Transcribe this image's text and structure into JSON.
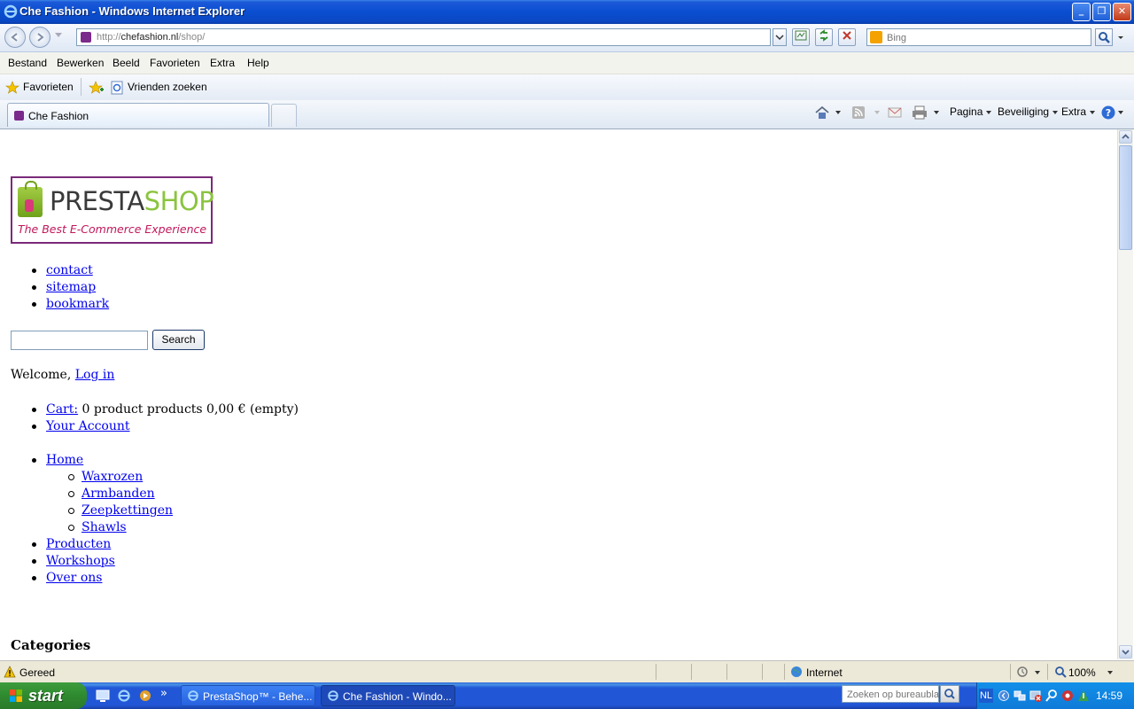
{
  "window": {
    "title": "Che Fashion - Windows Internet Explorer",
    "minimize_label": "_",
    "maximize_label": "❐",
    "close_label": "✕"
  },
  "address": {
    "url_prefix": "http://",
    "url_host": "chefashion.nl",
    "url_path": "/shop/",
    "search_placeholder": "Bing"
  },
  "menu": [
    "Bestand",
    "Bewerken",
    "Beeld",
    "Favorieten",
    "Extra",
    "Help"
  ],
  "favorites_bar": {
    "favorites_label": "Favorieten",
    "item_label": "Vrienden zoeken"
  },
  "tabs": [
    {
      "label": "Che Fashion"
    }
  ],
  "command_bar": {
    "page_label": "Pagina",
    "security_label": "Beveiliging",
    "extra_label": "Extra"
  },
  "page": {
    "logo": {
      "brand_main": "PRESTA",
      "brand_accent": "SHOP",
      "tagline": "The Best E-Commerce Experience"
    },
    "top_links": [
      "contact",
      "sitemap",
      "bookmark"
    ],
    "search_button": "Search",
    "welcome_text": "Welcome,",
    "login_link": "Log in",
    "cart": {
      "link": "Cart:",
      "text": "0 product products 0,00 € (empty)"
    },
    "account_link": "Your Account",
    "nav": {
      "home": "Home",
      "sub": [
        "Waxrozen",
        "Armbanden",
        "Zeepkettingen",
        "Shawls"
      ],
      "others": [
        "Producten",
        "Workshops",
        "Over ons"
      ]
    },
    "categories_heading": "Categories"
  },
  "status": {
    "text": "Gereed",
    "zone": "Internet",
    "zoom": "100%"
  },
  "taskbar": {
    "start_label": "start",
    "tasks": [
      {
        "label": "PrestaShop™ - Behe..."
      },
      {
        "label": "Che Fashion - Windo..."
      }
    ],
    "desktop_search_placeholder": "Zoeken op bureaublad",
    "language": "NL",
    "clock": "14:59"
  },
  "colors": {
    "link": "#0000ee",
    "brand_green": "#8bc43f",
    "brand_magenta": "#c2185b",
    "logo_border": "#7a2a7a",
    "titlebar_blue": "#0a4ed0"
  }
}
